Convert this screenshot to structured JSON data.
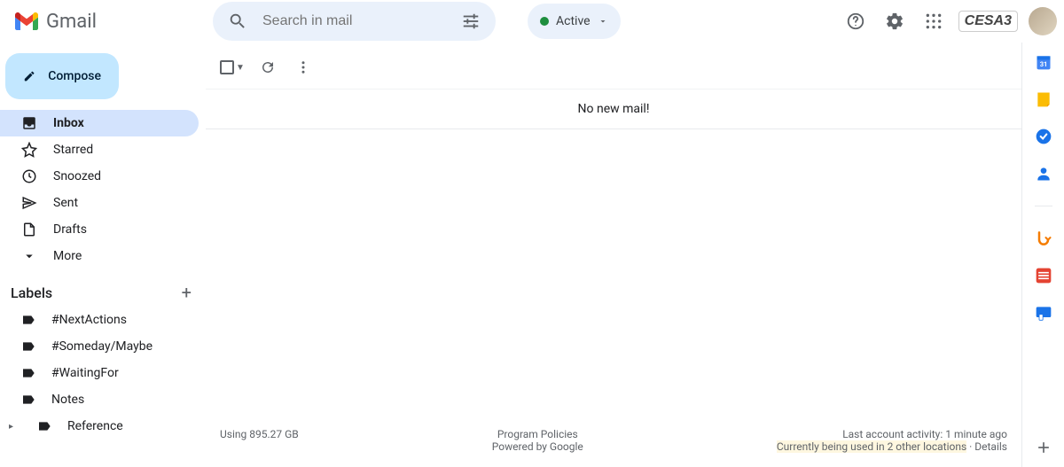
{
  "header": {
    "app_name": "Gmail",
    "search_placeholder": "Search in mail",
    "status_label": "Active",
    "brand_text": "CESA3"
  },
  "compose_label": "Compose",
  "nav": [
    {
      "id": "inbox",
      "label": "Inbox",
      "active": true
    },
    {
      "id": "starred",
      "label": "Starred",
      "active": false
    },
    {
      "id": "snoozed",
      "label": "Snoozed",
      "active": false
    },
    {
      "id": "sent",
      "label": "Sent",
      "active": false
    },
    {
      "id": "drafts",
      "label": "Drafts",
      "active": false
    },
    {
      "id": "more",
      "label": "More",
      "active": false
    }
  ],
  "labels_heading": "Labels",
  "labels": [
    {
      "label": "#NextActions"
    },
    {
      "label": "#Someday/Maybe"
    },
    {
      "label": "#WaitingFor"
    },
    {
      "label": "Notes"
    },
    {
      "label": "Reference",
      "expandable": true
    }
  ],
  "main": {
    "empty_message": "No new mail!"
  },
  "footer": {
    "storage": "Using 895.27 GB",
    "policies": "Program Policies",
    "powered": "Powered by Google",
    "activity": "Last account activity: 1 minute ago",
    "sessions": "Currently being used in 2 other locations",
    "details_sep": " · ",
    "details": "Details"
  }
}
